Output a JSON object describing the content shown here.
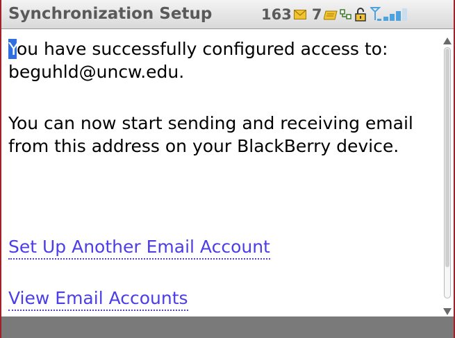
{
  "titlebar": {
    "title": "Synchronization Setup"
  },
  "status": {
    "unread_email_count": "163",
    "unread_folder_count": "7",
    "icons": [
      "envelope-icon",
      "folder-icon",
      "phone-icon",
      "lock-icon",
      "signal-icon"
    ],
    "signal_level_fraction": 0.6
  },
  "message": {
    "cursor_char": "Y",
    "paragraph1_rest": "ou have successfully configured access to: beguhld@uncw.edu.",
    "paragraph2": "You can now start sending and receiving email from this address on your BlackBerry device."
  },
  "links": {
    "setup_another": "Set Up Another Email Account",
    "view_accounts": "View Email Accounts"
  },
  "scrollbar": {
    "thumb_fraction": 0.88
  },
  "colors": {
    "frame_border": "#a3202a",
    "link": "#4b3ee6",
    "cursor_highlight": "#2f6fe0",
    "status_icon_accent": "#e8b400",
    "signal_accent": "#4da3e0"
  }
}
